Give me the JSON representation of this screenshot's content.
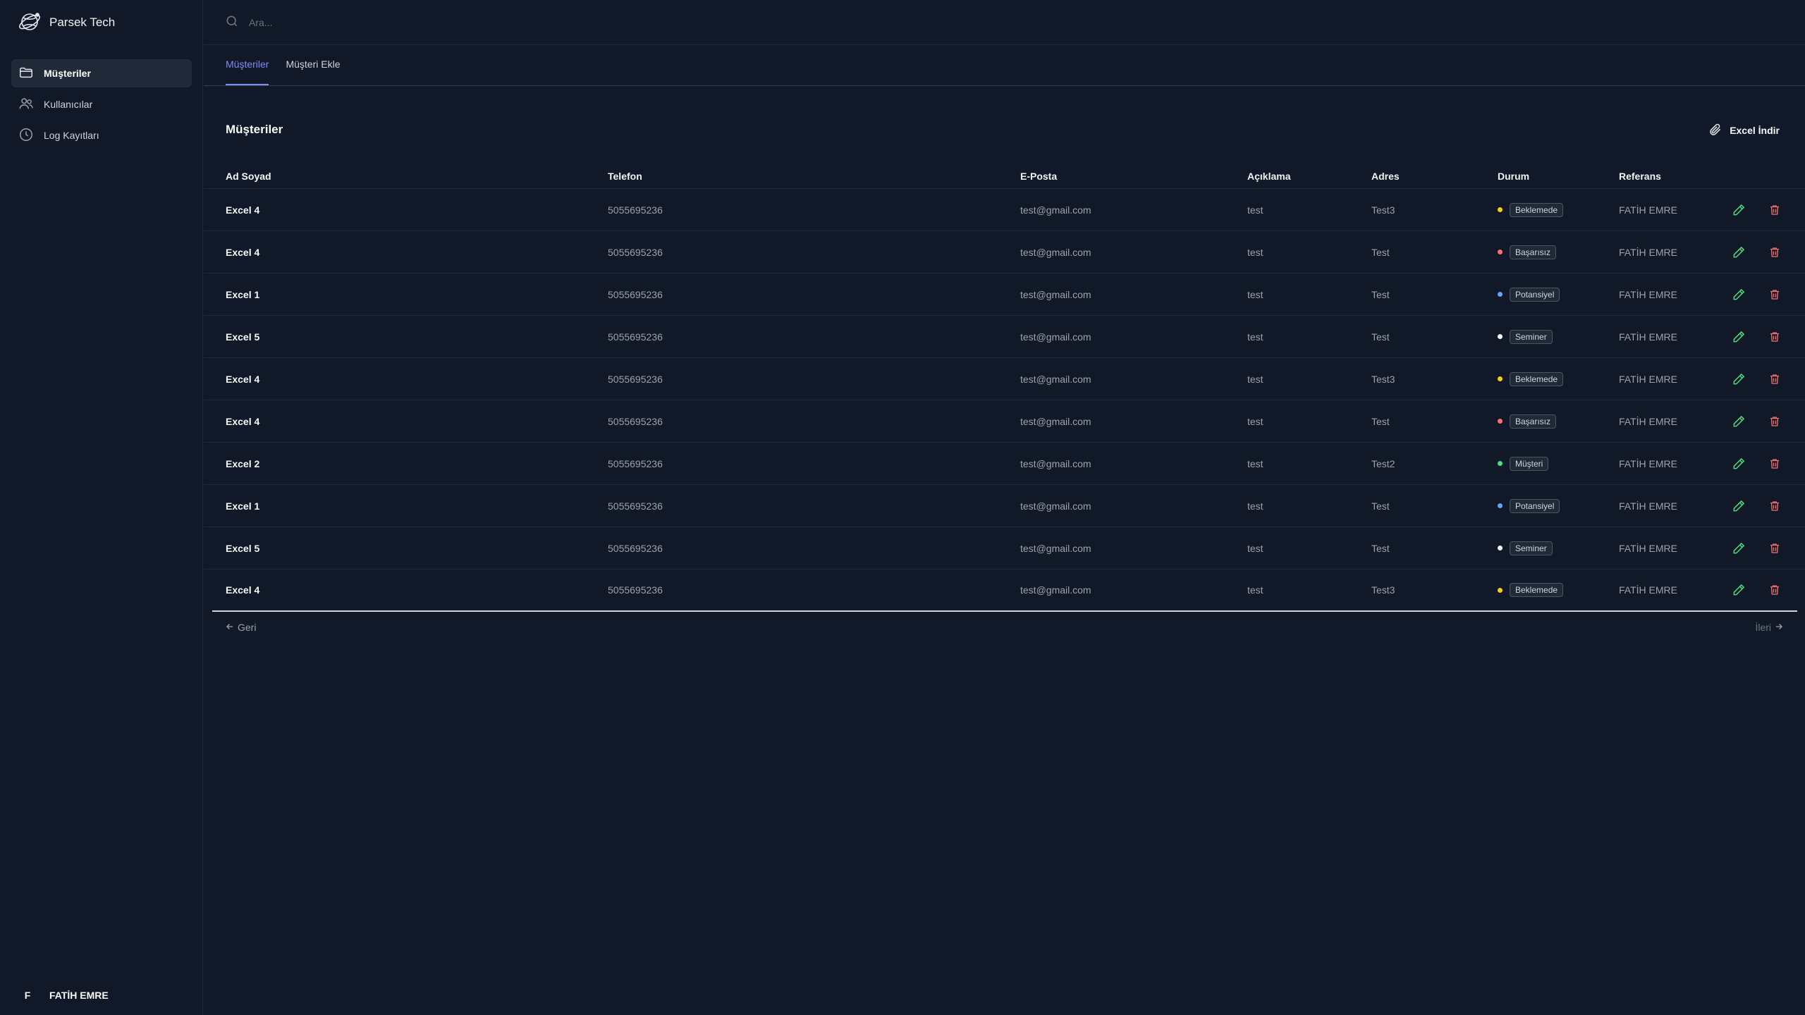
{
  "app": {
    "name": "Parsek Tech",
    "logo_icon": "globe-satellite-icon"
  },
  "sidebar": {
    "items": [
      {
        "label": "Müşteriler",
        "icon": "folder-icon",
        "active": true
      },
      {
        "label": "Kullanıcılar",
        "icon": "users-icon",
        "active": false
      },
      {
        "label": "Log Kayıtları",
        "icon": "clock-icon",
        "active": false
      }
    ],
    "user": {
      "initial": "F",
      "name": "FATİH EMRE"
    }
  },
  "search": {
    "placeholder": "Ara..."
  },
  "tabs": [
    {
      "label": "Müşteriler",
      "active": true
    },
    {
      "label": "Müşteri Ekle",
      "active": false
    }
  ],
  "section": {
    "title": "Müşteriler",
    "excel_label": "Excel İndir"
  },
  "table": {
    "headers": [
      "Ad Soyad",
      "Telefon",
      "E-Posta",
      "Açıklama",
      "Adres",
      "Durum",
      "Referans"
    ],
    "rows": [
      {
        "name": "Excel 4",
        "phone": "5055695236",
        "email": "test@gmail.com",
        "desc": "test",
        "addr": "Test3",
        "status": "Beklemede",
        "ref": "FATİH EMRE"
      },
      {
        "name": "Excel 4",
        "phone": "5055695236",
        "email": "test@gmail.com",
        "desc": "test",
        "addr": "Test",
        "status": "Başarısız",
        "ref": "FATİH EMRE"
      },
      {
        "name": "Excel 1",
        "phone": "5055695236",
        "email": "test@gmail.com",
        "desc": "test",
        "addr": "Test",
        "status": "Potansiyel",
        "ref": "FATİH EMRE"
      },
      {
        "name": "Excel 5",
        "phone": "5055695236",
        "email": "test@gmail.com",
        "desc": "test",
        "addr": "Test",
        "status": "Seminer",
        "ref": "FATİH EMRE"
      },
      {
        "name": "Excel 4",
        "phone": "5055695236",
        "email": "test@gmail.com",
        "desc": "test",
        "addr": "Test3",
        "status": "Beklemede",
        "ref": "FATİH EMRE"
      },
      {
        "name": "Excel 4",
        "phone": "5055695236",
        "email": "test@gmail.com",
        "desc": "test",
        "addr": "Test",
        "status": "Başarısız",
        "ref": "FATİH EMRE"
      },
      {
        "name": "Excel 2",
        "phone": "5055695236",
        "email": "test@gmail.com",
        "desc": "test",
        "addr": "Test2",
        "status": "Müşteri",
        "ref": "FATİH EMRE"
      },
      {
        "name": "Excel 1",
        "phone": "5055695236",
        "email": "test@gmail.com",
        "desc": "test",
        "addr": "Test",
        "status": "Potansiyel",
        "ref": "FATİH EMRE"
      },
      {
        "name": "Excel 5",
        "phone": "5055695236",
        "email": "test@gmail.com",
        "desc": "test",
        "addr": "Test",
        "status": "Seminer",
        "ref": "FATİH EMRE"
      },
      {
        "name": "Excel 4",
        "phone": "5055695236",
        "email": "test@gmail.com",
        "desc": "test",
        "addr": "Test3",
        "status": "Beklemede",
        "ref": "FATİH EMRE"
      }
    ]
  },
  "status_colors": {
    "Beklemede": "#facc15",
    "Başarısız": "#f87171",
    "Potansiyel": "#60a5fa",
    "Seminer": "#f9fafb",
    "Müşteri": "#4ade80"
  },
  "actions": {
    "edit_icon": "pencil-icon",
    "delete_icon": "trash-icon",
    "edit_color": "#4ade80",
    "delete_color": "#f87171"
  },
  "pagination": {
    "prev_label": "Geri",
    "next_label": "İleri"
  },
  "colors": {
    "background": "#111827",
    "accent": "#818cf8"
  }
}
